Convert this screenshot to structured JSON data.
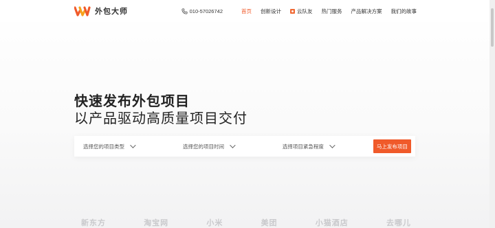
{
  "brand": {
    "name": "外包大师",
    "accent": "#f05a2a"
  },
  "header": {
    "phone": "010-57026742",
    "nav": [
      {
        "label": "首页",
        "active": true
      },
      {
        "label": "创新设计",
        "active": false
      },
      {
        "label": "云队友",
        "active": false
      },
      {
        "label": "热门服务",
        "active": false
      },
      {
        "label": "产品解决方案",
        "active": false
      },
      {
        "label": "我们的故事",
        "active": false
      }
    ]
  },
  "hero": {
    "title": "快速发布外包项目",
    "subtitle": "以产品驱动高质量项目交付"
  },
  "search": {
    "project_type": "选择您的项目类型",
    "project_time": "选择您的项目时间",
    "urgency": "选择项目紧急程度",
    "publish_label": "马上发布项目"
  },
  "partners": [
    "新东方",
    "淘宝网",
    "小米",
    "美团",
    "小猫酒店",
    "去哪儿"
  ]
}
